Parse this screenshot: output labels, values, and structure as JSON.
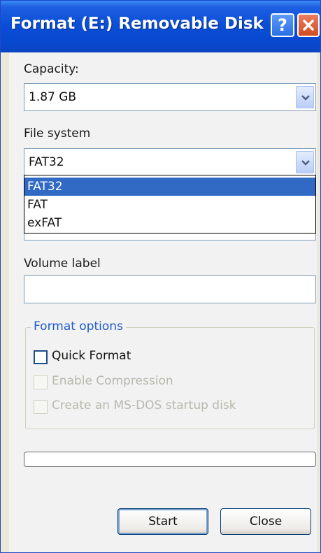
{
  "window": {
    "title": "Format (E:) Removable Disk",
    "help_label": "?",
    "accent": "#0a4fd6"
  },
  "capacity": {
    "label": "Capacity:",
    "value": "1.87 GB"
  },
  "file_system": {
    "label": "File system",
    "value": "FAT32",
    "options": [
      "FAT32",
      "FAT",
      "exFAT"
    ],
    "selected_index": 0
  },
  "volume_label": {
    "label": "Volume label",
    "value": ""
  },
  "format_options": {
    "legend": "Format options",
    "quick_format": {
      "label": "Quick Format",
      "checked": false,
      "enabled": true
    },
    "enable_compression": {
      "label": "Enable Compression",
      "checked": false,
      "enabled": false
    },
    "msdos_startup": {
      "label": "Create an MS-DOS startup disk",
      "checked": false,
      "enabled": false
    }
  },
  "progress": {
    "value": 0
  },
  "buttons": {
    "start": "Start",
    "close": "Close"
  },
  "icons": [
    "help-icon",
    "close-icon",
    "chevron-down-icon"
  ]
}
